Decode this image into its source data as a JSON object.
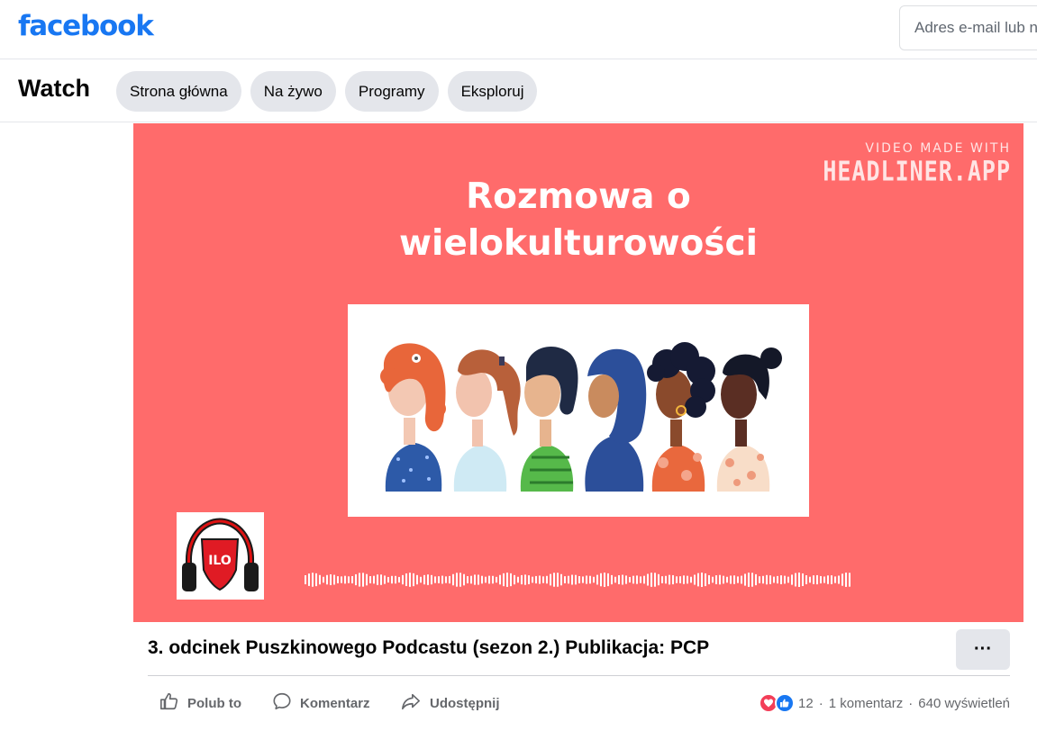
{
  "header": {
    "logo_text": "facebook",
    "email_placeholder": "Adres e-mail lub numer telefonu",
    "brand_color": "#1877f2"
  },
  "watch": {
    "title": "Watch",
    "tabs": [
      {
        "label": "Strona główna"
      },
      {
        "label": "Na żywo"
      },
      {
        "label": "Programy"
      },
      {
        "label": "Eksploruj"
      }
    ]
  },
  "video": {
    "background_color": "#ff6b6b",
    "watermark_line1": "VIDEO MADE WITH",
    "watermark_line2": "HEADLINER.APP",
    "title_line1": "Rozmowa o",
    "title_line2": "wielokulturowości",
    "logo_text": "ILO"
  },
  "post": {
    "title": "3. odcinek Puszkinowego Podcastu (sezon 2.) Publikacja: PCP",
    "more_label": "···",
    "actions": {
      "like": "Polub to",
      "comment": "Komentarz",
      "share": "Udostępnij"
    },
    "stats": {
      "reactions_count": "12",
      "comments": "1 komentarz",
      "views": "640 wyświetleń",
      "separator": "·"
    }
  }
}
